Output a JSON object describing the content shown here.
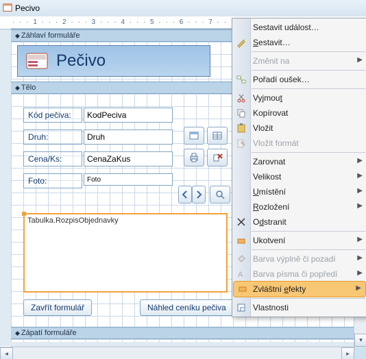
{
  "tab": {
    "title": "Pecivo"
  },
  "ruler": "·  ·  ·  1  ·  ·  ·  2  ·  ·  ·  3  ·  ·  ·  4  ·  ·  ·  5  ·  ·  ·  6  ·  ·  ·  7  ·  ·  ·  8  ·  ·  ·",
  "sections": {
    "header": "Záhlaví formuláře",
    "body": "Tělo",
    "footer": "Zápatí formuláře"
  },
  "form_title": "Pečivo",
  "labels": {
    "kod": "Kód pečiva:",
    "druh": "Druh:",
    "cena": "Cena/Ks:",
    "foto": "Foto:"
  },
  "fields": {
    "kod": "KodPeciva",
    "druh": "Druh",
    "cena": "CenaZaKus",
    "foto": "Foto"
  },
  "subform": {
    "caption": "Tabulka.RozpisObjednavky"
  },
  "buttons": {
    "close": "Zavřít formulář",
    "preview": "Náhled ceníku pečiva"
  },
  "menu": {
    "build_event": "Sestavit událost…",
    "build": "Sestavit…",
    "change_to": "Změnit na",
    "tab_order": "Pořadí oušek…",
    "cut": "Vyjmout",
    "copy": "Kopírovat",
    "paste": "Vložit",
    "paste_fmt": "Vložit formát",
    "align": "Zarovnat",
    "size": "Velikost",
    "position": "Umístění",
    "layout": "Rozložení",
    "delete": "Odstranit",
    "anchor": "Ukotvení",
    "fill_color": "Barva výplně či pozadí",
    "font_color": "Barva písma či popředí",
    "effects": "Zvláštní efekty",
    "properties": "Vlastnosti"
  }
}
